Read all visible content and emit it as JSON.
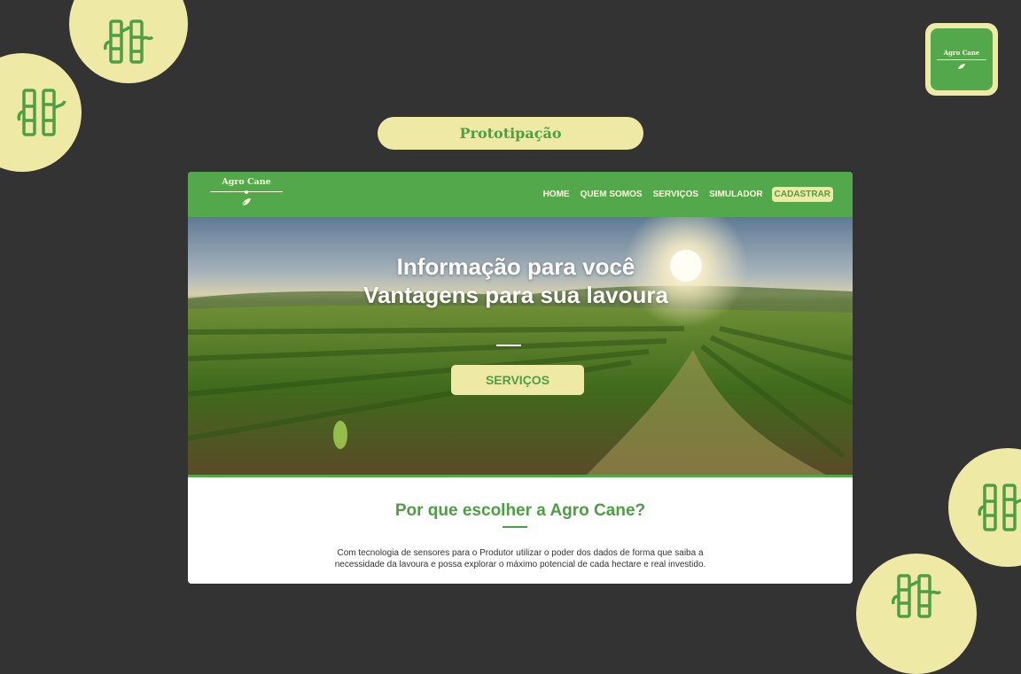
{
  "page": {
    "label": "Prototipação",
    "badge_logo_text": "Agro Cane"
  },
  "site": {
    "logo_text": "Agro Cane",
    "nav": {
      "items": [
        "HOME",
        "QUEM SOMOS",
        "SERVIÇOS",
        "SIMULADOR"
      ],
      "cta": "CADASTRAR"
    },
    "hero": {
      "title_line1": "Informação para você",
      "title_line2": "Vantagens para sua lavoura",
      "button": "SERVIÇOS"
    },
    "section": {
      "title": "Por que escolher a Agro Cane?",
      "text_line1": "Com tecnologia de sensores  para o Produtor  utilizar o poder dos dados de forma que saiba a",
      "text_line2": "necessidade da lavoura e possa explorar o máximo potencial de cada hectare e real investido."
    }
  },
  "colors": {
    "background": "#333333",
    "accent_green": "#52a84b",
    "cream": "#eeeaa6",
    "text_dark": "#333333"
  },
  "icons": [
    "bamboo-icon",
    "leaf-icon"
  ]
}
